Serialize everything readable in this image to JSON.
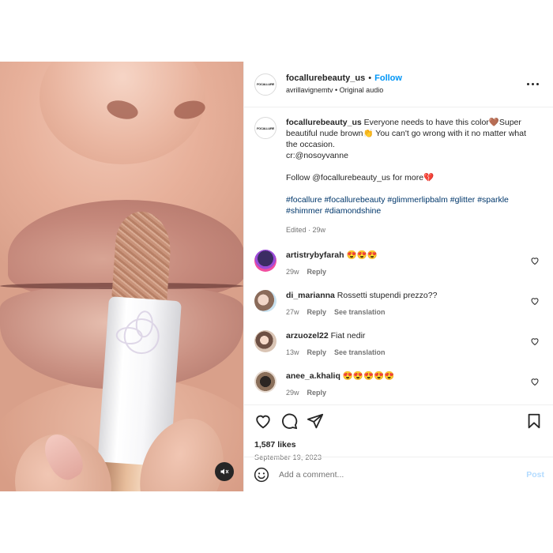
{
  "post": {
    "author": "focallurebeauty_us",
    "follow_label": "Follow",
    "dot": "•",
    "audio": "avrillavignemtv • Original audio",
    "avatar_logo": "FOCALLURE",
    "caption": {
      "text1": "Everyone needs to have this color🤎Super beautiful nude brown👏 You can't go wrong with it no matter what the occasion.",
      "credit": "cr:@nosoyvanne",
      "follow_line": "Follow @focallurebeauty_us for more💔",
      "hashtags": "#focallure #focallurebeauty #glimmerlipbalm #glitter #sparkle #shimmer #diamondshine",
      "meta": "Edited · 29w"
    },
    "comments": [
      {
        "user": "artistrybyfarah",
        "text": "😍😍😍",
        "age": "29w",
        "reply": "Reply",
        "translate": ""
      },
      {
        "user": "di_marianna",
        "text": "Rossetti stupendi prezzo??",
        "age": "27w",
        "reply": "Reply",
        "translate": "See translation"
      },
      {
        "user": "arzuozel22",
        "text": "Fiat nedir",
        "age": "13w",
        "reply": "Reply",
        "translate": "See translation"
      },
      {
        "user": "anee_a.khaliq",
        "text": "😍😍😍😍😍",
        "age": "29w",
        "reply": "Reply",
        "translate": ""
      }
    ],
    "likes": "1,587 likes",
    "date": "September 19, 2023",
    "add_comment_placeholder": "Add a comment...",
    "post_label": "Post"
  },
  "icons": {
    "more": "more-options-icon",
    "heart": "heart-icon",
    "comment": "comment-icon",
    "share": "share-icon",
    "bookmark": "bookmark-icon",
    "emoji": "emoji-icon",
    "mute": "mute-icon"
  },
  "colors": {
    "follow": "#0095f6",
    "hashtag": "#00376b",
    "muted_text": "#737373",
    "post_disabled": "#b3dbff"
  }
}
